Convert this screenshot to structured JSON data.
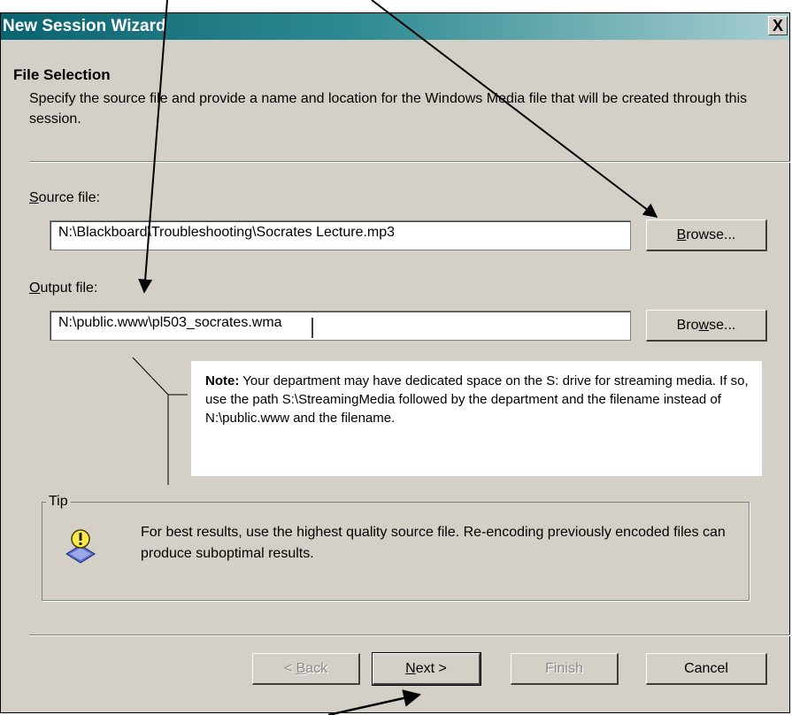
{
  "window": {
    "title": "New Session Wizard",
    "close_label": "X"
  },
  "header": {
    "title": "File Selection",
    "description": "Specify the source file and provide a name and location for the Windows Media file that will be created through this session."
  },
  "source": {
    "label_underlined": "S",
    "label_rest": "ource file:",
    "value": "N:\\Blackboard\\Troubleshooting\\Socrates Lecture.mp3",
    "browse_underlined": "B",
    "browse_rest": "rowse..."
  },
  "output": {
    "label_underlined": "O",
    "label_rest": "utput file:",
    "value": "N:\\public.www\\pl503_socrates.wma",
    "browse_pre": "Bro",
    "browse_underlined": "w",
    "browse_post": "se..."
  },
  "note": {
    "bold": "Note:",
    "text": " Your department may have dedicated space on the S: drive for streaming media. If so, use the path S:\\StreamingMedia followed by the department and the filename instead of N:\\public.www and the filename."
  },
  "tip": {
    "legend": "Tip",
    "text": "For best results, use the highest quality source file. Re-encoding previously encoded files can produce suboptimal results."
  },
  "footer": {
    "back_pre": "< ",
    "back_underlined": "B",
    "back_post": "ack",
    "next_underlined": "N",
    "next_post": "ext >",
    "finish": "Finish",
    "cancel": "Cancel"
  },
  "icons": {
    "tip": "lightbulb-icon",
    "close": "close-icon"
  },
  "colors": {
    "titlebar_start": "#0a6470",
    "titlebar_end": "#a8cfd2",
    "dialog_bg": "#d4d0c8"
  }
}
